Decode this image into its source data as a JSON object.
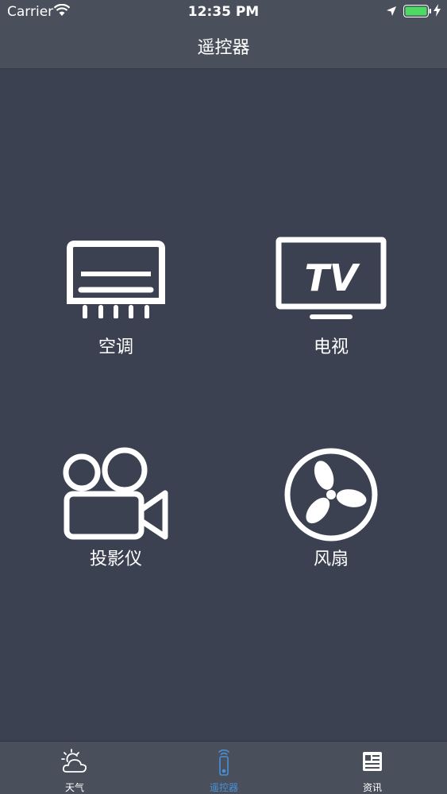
{
  "status_bar": {
    "carrier": "Carrier",
    "time": "12:35 PM",
    "battery_color": "#4cd964"
  },
  "navbar": {
    "title": "遥控器"
  },
  "devices": [
    {
      "label": "空调",
      "icon": "air-conditioner-icon"
    },
    {
      "label": "电视",
      "icon": "tv-icon",
      "icon_text": "TV"
    },
    {
      "label": "投影仪",
      "icon": "projector-camera-icon"
    },
    {
      "label": "风扇",
      "icon": "fan-icon"
    }
  ],
  "tabbar": {
    "active_color": "#4a8fd9",
    "tabs": [
      {
        "label": "天气",
        "icon": "weather-icon",
        "active": false
      },
      {
        "label": "遥控器",
        "icon": "remote-icon",
        "active": true
      },
      {
        "label": "资讯",
        "icon": "news-icon",
        "active": false
      }
    ]
  }
}
